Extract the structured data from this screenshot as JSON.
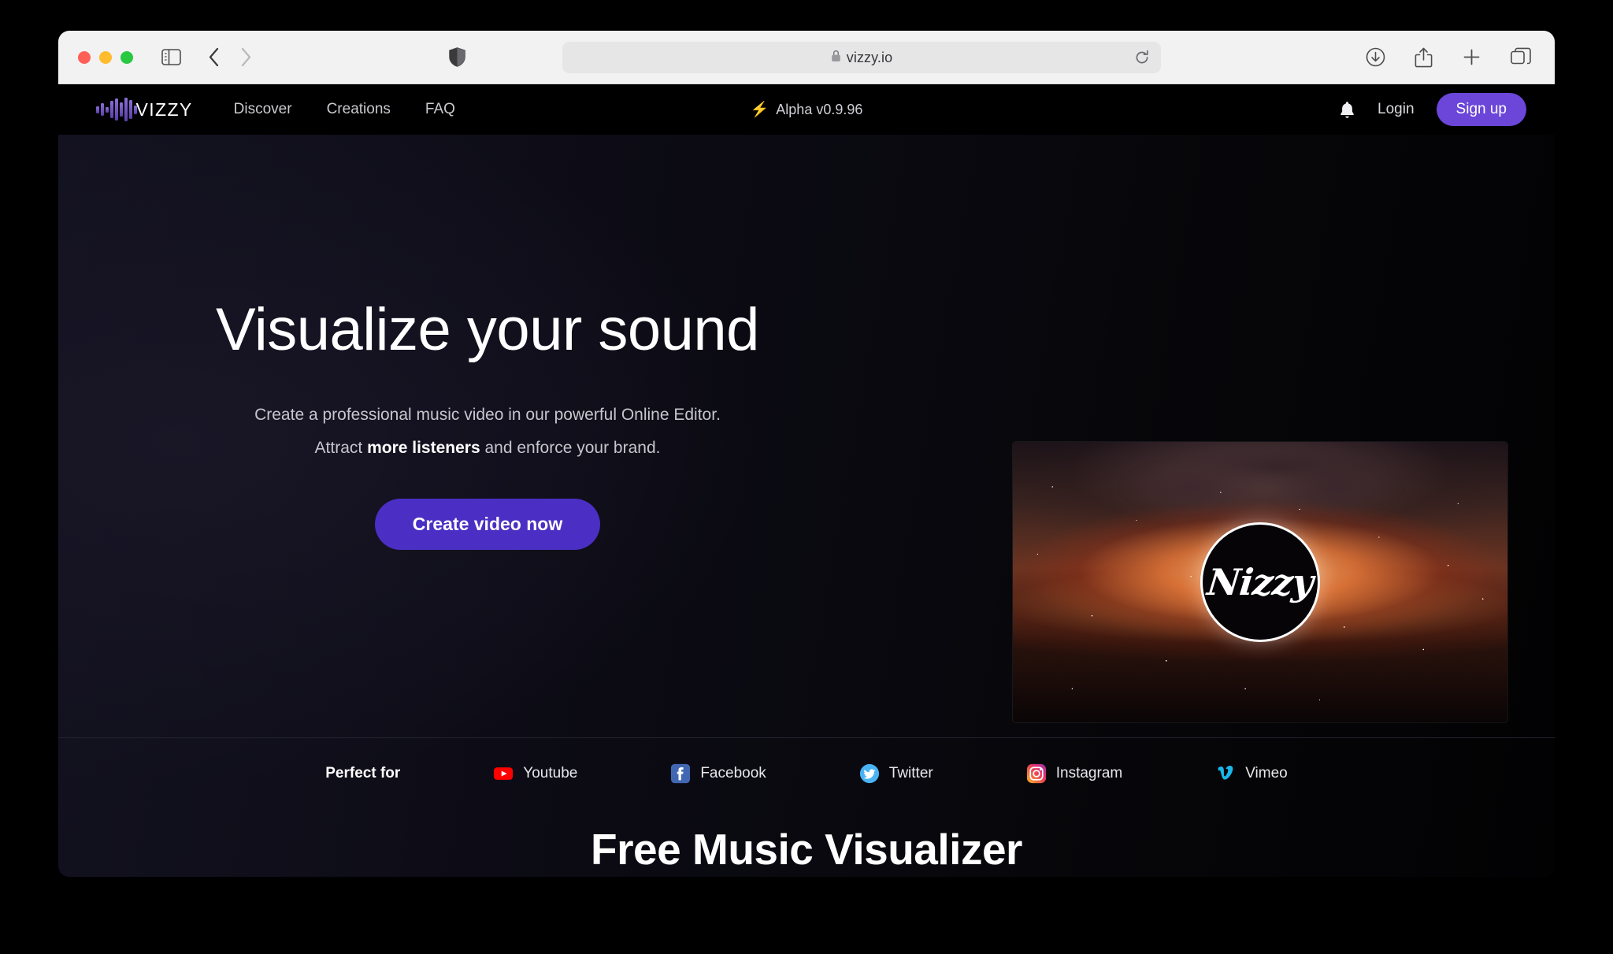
{
  "browser": {
    "url": "vizzy.io",
    "traffic_lights": [
      "close",
      "minimize",
      "maximize"
    ],
    "toolbar_icons": [
      "sidebar-toggle",
      "back",
      "forward",
      "shield",
      "reload",
      "download",
      "share",
      "new-tab",
      "tab-overview"
    ]
  },
  "site_nav": {
    "brand": "VIZZY",
    "links": [
      {
        "label": "Discover"
      },
      {
        "label": "Creations"
      },
      {
        "label": "FAQ"
      }
    ],
    "version": "Alpha v0.9.96",
    "version_icon": "lightning-bolt-icon",
    "bolt_glyph": "⚡",
    "login_label": "Login",
    "signup_label": "Sign up"
  },
  "hero": {
    "title": "Visualize your sound",
    "subtitle_line1": "Create a professional music video in our powerful Online Editor.",
    "subtitle_line2_pre": "Attract ",
    "subtitle_line2_bold": "more listeners",
    "subtitle_line2_post": " and enforce your brand.",
    "cta_label": "Create video now",
    "video_logo_text": "Nizzy"
  },
  "social": {
    "heading": "Perfect for",
    "platforms": [
      {
        "label": "Youtube",
        "icon": "youtube-icon",
        "color": "#ff0000"
      },
      {
        "label": "Facebook",
        "icon": "facebook-icon",
        "color": "#4267b2"
      },
      {
        "label": "Twitter",
        "icon": "twitter-icon",
        "color": "#1da1f2"
      },
      {
        "label": "Instagram",
        "icon": "instagram-icon",
        "color": "#e1306c"
      },
      {
        "label": "Vimeo",
        "icon": "vimeo-icon",
        "color": "#1ab7ea"
      }
    ]
  },
  "bottom": {
    "title": "Free Music Visualizer"
  },
  "colors": {
    "accent_purple": "#6b46d9",
    "cta_purple": "#4b2fc4",
    "page_bg": "#0d0c16",
    "nav_bg": "#000000"
  }
}
